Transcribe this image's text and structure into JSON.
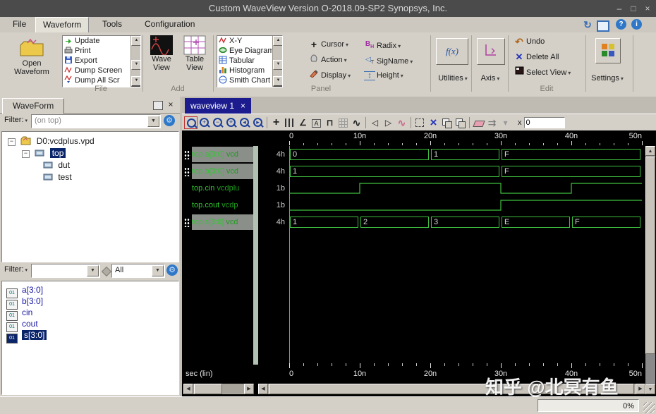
{
  "window": {
    "title": "Custom WaveView Version O-2018.09-SP2 Synopsys, Inc.",
    "minimize": "–",
    "maximize": "□",
    "close": "×"
  },
  "menu": {
    "file": "File",
    "waveform": "Waveform",
    "tools": "Tools",
    "configuration": "Configuration"
  },
  "ribbon": {
    "open_waveform": "Open Waveform",
    "file_group": {
      "label": "File",
      "items": [
        "Update",
        "Print",
        "Export",
        "Dump Screen",
        "Dump All Scr"
      ]
    },
    "add_group": {
      "label": "Add",
      "wave_view": "Wave View",
      "table_view": "Table View"
    },
    "panel_group": {
      "label": "Panel",
      "views": [
        "X-Y",
        "Eye Diagram",
        "Tabular",
        "Histogram",
        "Smith Chart"
      ],
      "cursor": "Cursor",
      "action": "Action",
      "display": "Display",
      "radix": "Radix",
      "signame": "SigName",
      "height": "Height"
    },
    "utilities": "Utilities",
    "axis": "Axis",
    "edit_group": {
      "label": "Edit",
      "undo": "Undo",
      "delete_all": "Delete All",
      "select_view": "Select View"
    },
    "settings": "Settings"
  },
  "left_panel": {
    "tab": "WaveForm",
    "filter_top": {
      "label": "Filter:",
      "value": "(on top)"
    },
    "tree": {
      "root": "D0:vcdplus.vpd",
      "top": "top",
      "dut": "dut",
      "test": "test"
    },
    "filter_bottom": {
      "label": "Filter:",
      "value": "",
      "scope": "All"
    },
    "signals": [
      "a[3:0]",
      "b[3:0]",
      "cin",
      "cout",
      "s[3:0]"
    ],
    "selected_signal": "s[3:0]"
  },
  "waveview": {
    "tab": "waveview 1",
    "tab_close": "×",
    "x_label": "x",
    "x_value": "0"
  },
  "chart_data": {
    "type": "digital-waveform",
    "x_unit": "ns",
    "xlim": [
      0,
      50
    ],
    "x_tick_values": [
      0,
      10,
      20,
      30,
      40,
      50
    ],
    "x_tick_labels": [
      "0",
      "10n",
      "20n",
      "30n",
      "40n",
      "50n"
    ],
    "minor_tick_step": 2,
    "axis_label": "sec (lin)",
    "colors": {
      "trace": "#3fbf3f",
      "background": "#000000",
      "label": "#dcdcdc",
      "name": "#2ec82e",
      "selected_row": "#8a8f8a"
    },
    "signals": [
      {
        "name": "top.a[3:0]",
        "source": "vcd",
        "radix": "4h",
        "kind": "bus",
        "selected": true,
        "segments": [
          {
            "t0": 0,
            "t1": 20,
            "value": "0"
          },
          {
            "t0": 20,
            "t1": 30,
            "value": "1"
          },
          {
            "t0": 30,
            "t1": 50,
            "value": "F"
          }
        ]
      },
      {
        "name": "top.b[3:0]",
        "source": "vcd",
        "radix": "4h",
        "kind": "bus",
        "selected": true,
        "segments": [
          {
            "t0": 0,
            "t1": 30,
            "value": "1"
          },
          {
            "t0": 30,
            "t1": 50,
            "value": "F"
          }
        ]
      },
      {
        "name": "top.cin",
        "source": "vcdplu",
        "radix": "1b",
        "kind": "bit",
        "selected": false,
        "segments": [
          {
            "t0": 0,
            "t1": 10,
            "level": 0
          },
          {
            "t0": 10,
            "t1": 30,
            "level": 1
          },
          {
            "t0": 30,
            "t1": 40,
            "level": 0
          },
          {
            "t0": 40,
            "t1": 50,
            "level": 1
          }
        ]
      },
      {
        "name": "top.cout",
        "source": "vcdp",
        "radix": "1b",
        "kind": "bit",
        "selected": false,
        "segments": [
          {
            "t0": 0,
            "t1": 30,
            "level": 0
          },
          {
            "t0": 30,
            "t1": 50,
            "level": 1
          }
        ]
      },
      {
        "name": "top.s[3:0]",
        "source": "vcd",
        "radix": "4h",
        "kind": "bus",
        "selected": true,
        "segments": [
          {
            "t0": 0,
            "t1": 10,
            "value": "1"
          },
          {
            "t0": 10,
            "t1": 20,
            "value": "2"
          },
          {
            "t0": 20,
            "t1": 30,
            "value": "3"
          },
          {
            "t0": 30,
            "t1": 40,
            "value": "E"
          },
          {
            "t0": 40,
            "t1": 50,
            "value": "F"
          }
        ]
      }
    ]
  },
  "status": {
    "progress": "0%"
  },
  "watermark": "知乎 @北冥有鱼"
}
